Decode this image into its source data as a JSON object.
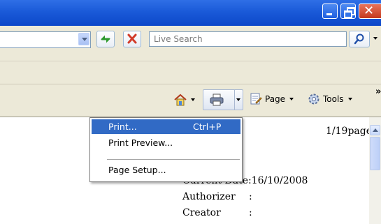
{
  "toolbar": {
    "search_placeholder": "Live Search",
    "page_label": "Page",
    "tools_label": "Tools"
  },
  "menu": {
    "items": [
      {
        "label": "Print...",
        "shortcut": "Ctrl+P"
      },
      {
        "label": "Print Preview..."
      },
      {
        "label": "Page Setup..."
      }
    ]
  },
  "document": {
    "page_counter": "1/19page",
    "current_date_label": "Current Date:16/10/2008",
    "authorizer_label": "Authorizer",
    "authorizer_value": ":",
    "creator_label": "Creator",
    "creator_value": ":"
  },
  "colors": {
    "title_bar": "#1a5ad8",
    "menu_highlight": "#316ac5",
    "toolbar_bg": "#ece9d8"
  }
}
